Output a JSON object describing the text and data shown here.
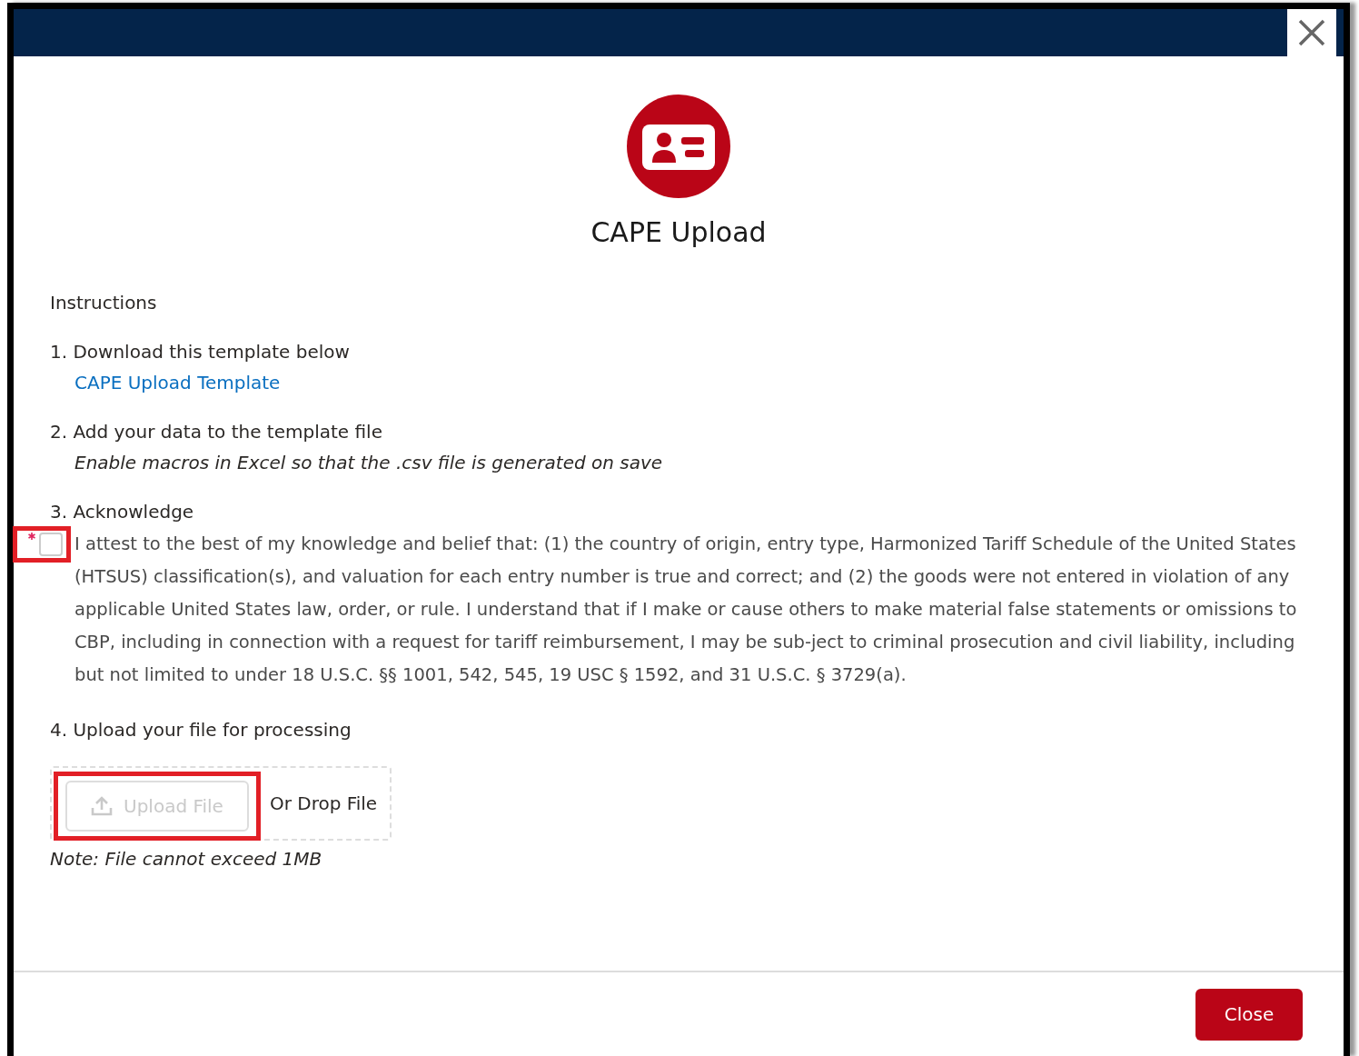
{
  "title": "CAPE Upload",
  "instructions_heading": "Instructions",
  "steps": [
    {
      "kind": "link",
      "title": "1. Download this template below",
      "link": "CAPE Upload Template"
    },
    {
      "kind": "note",
      "title": "2. Add your data to the template file",
      "note": "Enable macros in Excel so that the .csv file is generated on save"
    },
    {
      "kind": "checkbox",
      "title": "3. Acknowledge",
      "checkbox": {
        "required": true,
        "checked": false,
        "highlighted": true,
        "label": "I attest to the best of my knowledge and belief that: (1) the country of origin, entry type, Harmonized Tariff Schedule of the United States (HTSUS) classification(s), and valuation for each entry number is true and correct; and (2) the goods were not entered in violation of any applicable United States law, order, or rule. I understand that if I make or cause others to make material false statements or omissions to CBP, including in connection with a request for tariff reimbursement, I may be sub-ject to criminal prosecution and civil liability, including but not limited to under 18 U.S.C. §§ 1001, 542, 545, 19 USC § 1592, and 31 U.S.C. § 3729(a)."
      }
    },
    {
      "kind": "upload",
      "title": "4. Upload your file for processing",
      "upload": {
        "button": "Upload File",
        "disabled": true,
        "highlighted": true,
        "drop_text": "Or Drop File"
      },
      "note": "Note: File cannot exceed 1MB"
    }
  ],
  "footer": {
    "button": "Close"
  }
}
